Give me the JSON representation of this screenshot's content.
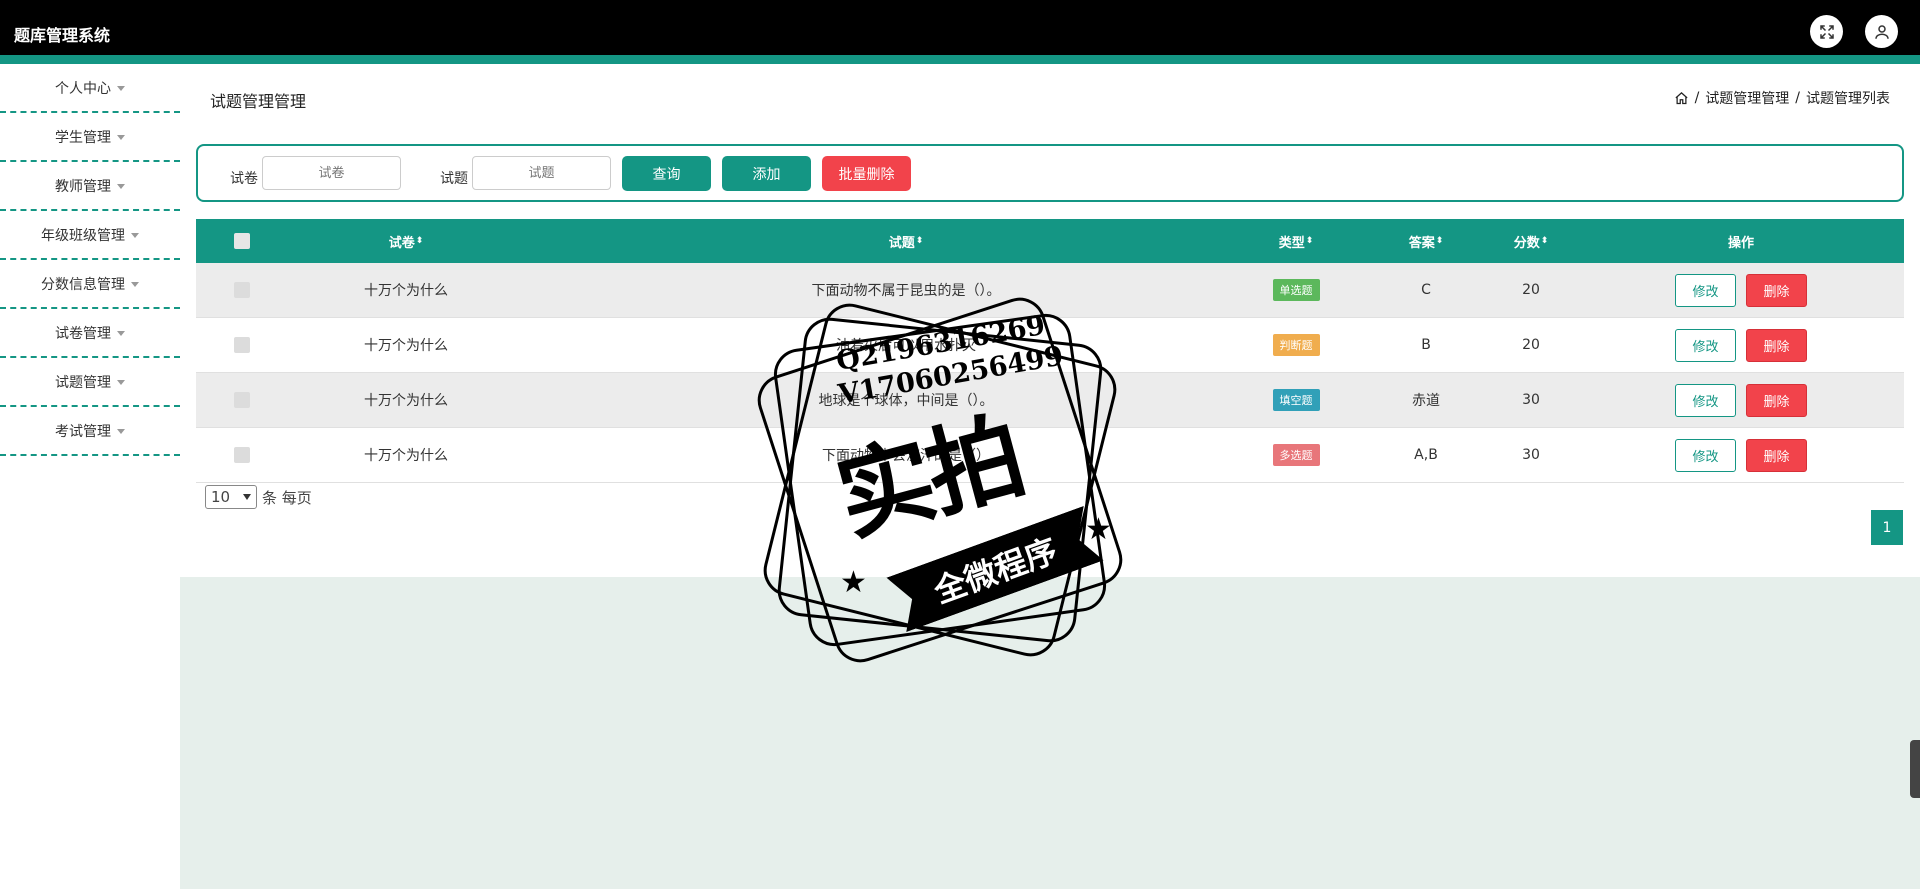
{
  "app": {
    "title": "题库管理系统"
  },
  "header_icons": {
    "fullscreen": "fullscreen-icon",
    "user": "user-icon"
  },
  "sidebar": {
    "items": [
      {
        "label": "个人中心"
      },
      {
        "label": "学生管理"
      },
      {
        "label": "教师管理"
      },
      {
        "label": "年级班级管理"
      },
      {
        "label": "分数信息管理"
      },
      {
        "label": "试卷管理"
      },
      {
        "label": "试题管理"
      },
      {
        "label": "考试管理"
      }
    ]
  },
  "page": {
    "title": "试题管理管理",
    "breadcrumb": {
      "sep": "/",
      "level1": "试题管理管理",
      "level2": "试题管理列表"
    }
  },
  "search": {
    "paper_label": "试卷",
    "paper_placeholder": "试卷",
    "question_label": "试题",
    "question_placeholder": "试题",
    "query_button": "查询",
    "add_button": "添加",
    "batch_delete_button": "批量删除"
  },
  "table": {
    "headers": {
      "paper": "试卷",
      "question": "试题",
      "type": "类型",
      "answer": "答案",
      "score": "分数",
      "actions": "操作"
    },
    "sort_glyph": "⬍",
    "edit_label": "修改",
    "delete_label": "删除",
    "rows": [
      {
        "paper": "十万个为什么",
        "question": "下面动物不属于昆虫的是（）。",
        "type": "单选题",
        "type_color": "#5cb85c",
        "answer": "C",
        "score": "20"
      },
      {
        "paper": "十万个为什么",
        "question": "油着火后可以用水扑灭",
        "type": "判断题",
        "type_color": "#f0ad4e",
        "answer": "B",
        "score": "20"
      },
      {
        "paper": "十万个为什么",
        "question": "地球是个球体，中间是（）。",
        "type": "填空题",
        "type_color": "#31a0b8",
        "answer": "赤道",
        "score": "30"
      },
      {
        "paper": "十万个为什么",
        "question": "下面动物中会流汗的是（）",
        "type": "多选题",
        "type_color": "#e8767a",
        "answer": "A,B",
        "score": "30"
      }
    ]
  },
  "pagination": {
    "page_size": "10",
    "per_page_label": "条 每页",
    "current_page": "1"
  },
  "watermark": {
    "line1": "Q2196316269",
    "line2": "V17060256499",
    "big": "实拍",
    "banner": "全微程序"
  }
}
